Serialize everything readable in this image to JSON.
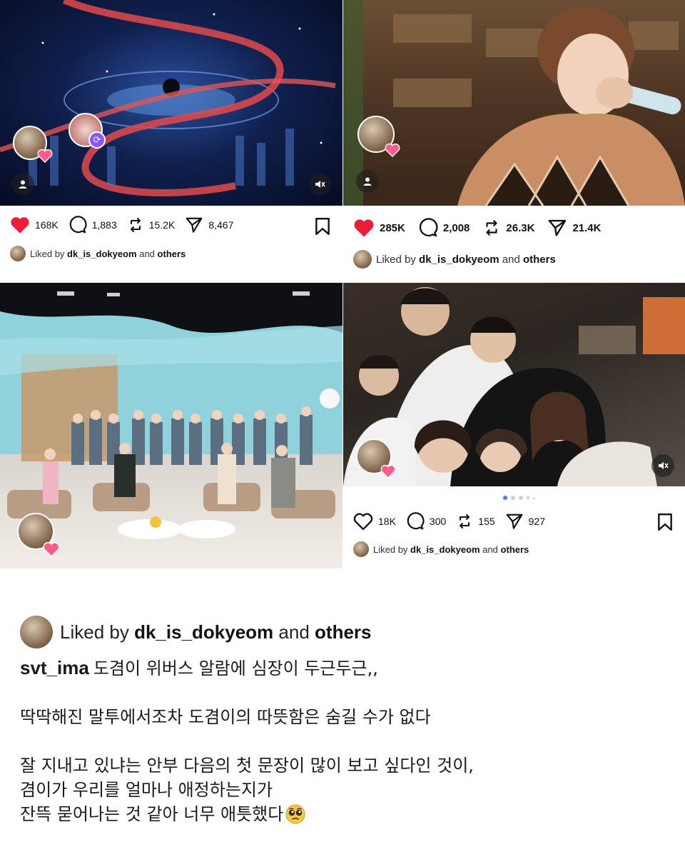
{
  "posts": [
    {
      "likes": "168K",
      "comments": "1,883",
      "reposts": "15.2K",
      "shares": "8,467",
      "liked_by_prefix": "Liked by",
      "liked_by_user": "dk_is_dokyeom",
      "liked_by_and": "and",
      "liked_by_others": "others",
      "liked_state": "filled",
      "bookmark_visible": true
    },
    {
      "likes": "285K",
      "comments": "2,008",
      "reposts": "26.3K",
      "shares": "21.4K",
      "liked_by_prefix": "Liked by",
      "liked_by_user": "dk_is_dokyeom",
      "liked_by_and": "and",
      "liked_by_others": "others",
      "liked_state": "filled",
      "bookmark_visible": false
    },
    {
      "likes": "",
      "comments": "",
      "reposts": "",
      "shares": "",
      "bookmark_visible": false
    },
    {
      "likes": "18K",
      "comments": "300",
      "reposts": "155",
      "shares": "927",
      "liked_by_prefix": "Liked by",
      "liked_by_user": "dk_is_dokyeom",
      "liked_by_and": "and",
      "liked_by_others": "others",
      "liked_state": "outline",
      "bookmark_visible": true,
      "carousel_pages": 5,
      "carousel_active": 1
    }
  ],
  "caption": {
    "liked_by_prefix": "Liked by",
    "liked_by_user": "dk_is_dokyeom",
    "liked_by_and": "and",
    "liked_by_others": "others",
    "username": "svt_ima",
    "line1": "도겸이 위버스 알람에 심장이 두근두근,,",
    "line2": "딱딱해진 말투에서조차 도겸이의 따뜻함은 숨길 수가 없다",
    "line3": "잘 지내고 있냐는 안부 다음의 첫 문장이 많이 보고 싶다인 것이,",
    "line4": "겸이가 우리를 얼마나 애정하는지가",
    "line5": "잔뜩 묻어나는 것 같아 너무 애틋했다",
    "emoji": "pleading-face"
  },
  "colors": {
    "heart": "#ed1d3a",
    "text": "#111111",
    "carousel_active": "#3b82f6"
  }
}
